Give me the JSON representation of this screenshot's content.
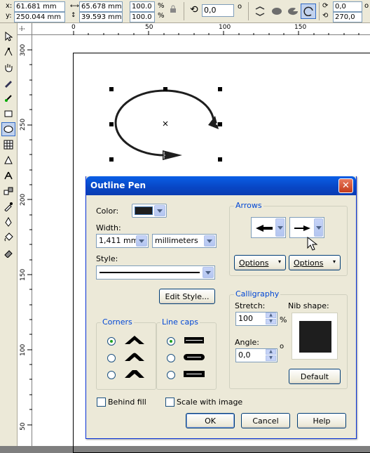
{
  "propbar": {
    "x_label": "x:",
    "y_label": "y:",
    "x_value": "61.681 mm",
    "y_value": "250.044 mm",
    "width_value": "65.678 mm",
    "height_value": "39.593 mm",
    "scale_x": "100.0",
    "scale_y": "100.0",
    "percent_sign": "%",
    "rotation": "0,0",
    "degree_sign": "o",
    "angle_start": "0,0",
    "angle_end": "270,0"
  },
  "ruler": {
    "h_ticks": [
      "0",
      "50",
      "100",
      "150"
    ],
    "v_ticks": [
      "300",
      "250",
      "200",
      "150",
      "100",
      "50"
    ]
  },
  "dialog": {
    "title": "Outline Pen",
    "close_glyph": "✕",
    "color_label": "Color:",
    "width_label": "Width:",
    "width_value": "1,411 mm",
    "width_unit": "millimeters",
    "style_label": "Style:",
    "edit_style_button": "Edit Style...",
    "corners_title": "Corners",
    "line_caps_title": "Line caps",
    "arrows_title": "Arrows",
    "options_left": "Options",
    "options_right": "Options",
    "calligraphy_title": "Calligraphy",
    "stretch_label": "Stretch:",
    "stretch_value": "100",
    "stretch_unit": "%",
    "nib_shape_label": "Nib shape:",
    "angle_label": "Angle:",
    "angle_value": "0,0",
    "angle_unit": "o",
    "default_button": "Default",
    "behind_fill_label": "Behind fill",
    "scale_with_image_label": "Scale with image",
    "ok_button": "OK",
    "cancel_button": "Cancel",
    "help_button": "Help",
    "outline_color": "#1e1e1e"
  }
}
